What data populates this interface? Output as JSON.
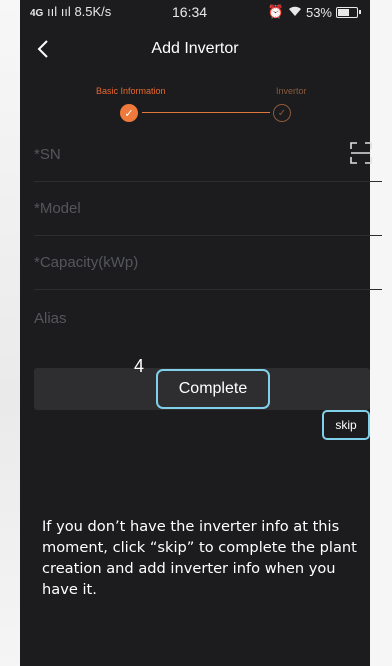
{
  "status_bar": {
    "network": "4G",
    "signal": "ııl  ııl",
    "speed": "8.5K/s",
    "time": "16:34",
    "battery": "53%"
  },
  "nav": {
    "title": "Add Invertor",
    "back_icon": "chevron-left-icon"
  },
  "stepper": {
    "step1_label": "Basic Information",
    "step2_label": "Invertor",
    "accent_color": "#ef7a3c"
  },
  "form": {
    "sn_placeholder": "*SN",
    "model_placeholder": "*Model",
    "capacity_placeholder": "*Capacity(kWp)",
    "alias_placeholder": "Alias",
    "scan_icon": "scan-icon"
  },
  "actions": {
    "callout_number": "4",
    "complete_label": "Complete",
    "skip_label": "skip",
    "highlight_color": "#7fd0e8"
  },
  "help": {
    "text": "If you don’t have the inverter info at this moment, click “skip” to complete the plant creation and add inverter info when you have it."
  }
}
